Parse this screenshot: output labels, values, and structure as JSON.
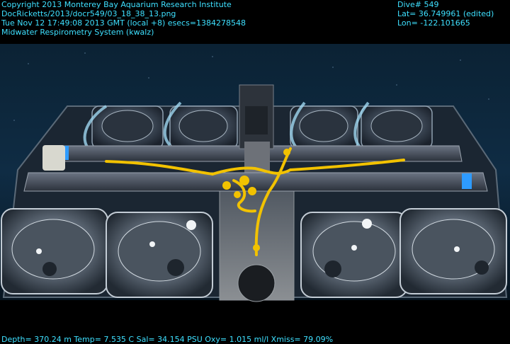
{
  "overlay": {
    "copyright": "Copyright 2013 Monterey Bay Aquarium Research Institute",
    "filename": "DocRicketts/2013/docr549/03_18_38_13.png",
    "timestamp": "Tue Nov 12 17:49:08 2013 GMT (local +8)  esecs=1384278548",
    "system": "Midwater Respirometry System (kwalz)",
    "dive": "Dive# 549",
    "lat": "Lat= 36.749961 (edited)",
    "lon": "Lon= -122.101665",
    "sensors": "Depth= 370.24 m  Temp= 7.535 C  Sal= 34.154 PSU  Oxy= 1.015 ml/l  Xmiss= 79.09%"
  },
  "colors": {
    "overlay_text": "#3ee0ff",
    "water_top": "#0e2a40",
    "water_bottom": "#081826",
    "tether": "#f2c200",
    "frame_bar": "#3a4250",
    "accent_blue": "#2e9bff"
  },
  "scene": {
    "description_icons": [
      "respirometer-chamber-icon",
      "tether-icon",
      "frame-bar-icon"
    ]
  }
}
